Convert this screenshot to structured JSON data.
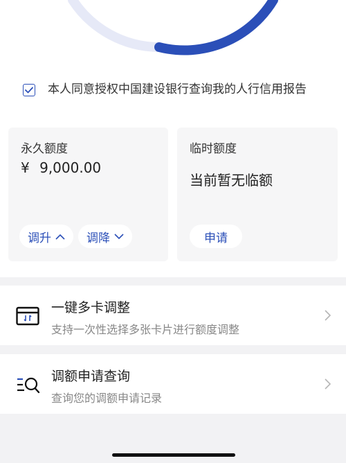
{
  "consent": {
    "checked": true,
    "text": "本人同意授权中国建设银行查询我的人行信用报告"
  },
  "permanent_limit": {
    "title": "永久额度",
    "currency": "¥",
    "amount": "9,000.00",
    "increase_label": "调升",
    "decrease_label": "调降"
  },
  "temporary_limit": {
    "title": "临时额度",
    "status": "当前暂无临额",
    "apply_label": "申请"
  },
  "menu": [
    {
      "title": "一键多卡调整",
      "subtitle": "支持一次性选择多张卡片进行额度调整",
      "icon": "card-transfer-icon"
    },
    {
      "title": "调额申请查询",
      "subtitle": "查询您的调额申请记录",
      "icon": "search-list-icon"
    }
  ],
  "colors": {
    "accent": "#2b4fb8",
    "gauge_track": "#e6e9f7"
  }
}
